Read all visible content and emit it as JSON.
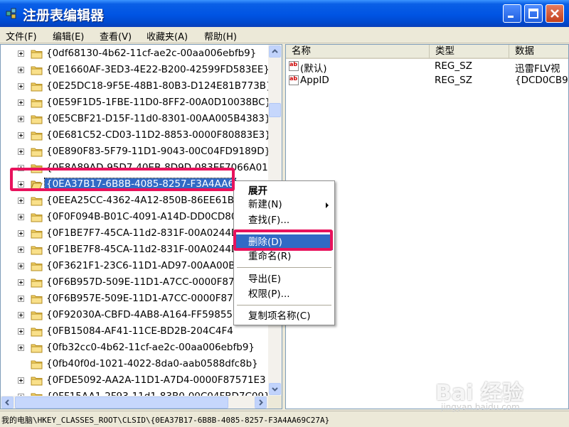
{
  "window": {
    "title": "注册表编辑器",
    "controls": {
      "minimize": "minimize",
      "maximize": "maximize",
      "close": "close"
    }
  },
  "menu": [
    "文件(F)",
    "编辑(E)",
    "查看(V)",
    "收藏夹(A)",
    "帮助(H)"
  ],
  "tree": {
    "items": [
      {
        "label": "{0df68130-4b62-11cf-ae2c-00aa006ebfb9}",
        "expandable": true
      },
      {
        "label": "{0E1660AF-3ED3-4E22-B200-42599FD583EE}",
        "expandable": true
      },
      {
        "label": "{0E25DC18-9F5E-48B1-80B3-D124E81B773B}",
        "expandable": true
      },
      {
        "label": "{0E59F1D5-1FBE-11D0-8FF2-00A0D10038BC}",
        "expandable": true
      },
      {
        "label": "{0E5CBF21-D15F-11d0-8301-00AA005B4383}",
        "expandable": true
      },
      {
        "label": "{0E681C52-CD03-11D2-8853-0000F80883E3}",
        "expandable": true
      },
      {
        "label": "{0E890F83-5F79-11D1-9043-00C04FD9189D}",
        "expandable": true
      },
      {
        "label": "{0E8A89AD-95D7-40EB-8D9D-083EF7066A01",
        "expandable": true
      },
      {
        "label": "{0EA37B17-6B8B-4085-8257-F3A4AA6",
        "expandable": true,
        "selected": true
      },
      {
        "label": "{0EEA25CC-4362-4A12-850B-86EE61B",
        "expandable": true
      },
      {
        "label": "{0F0F094B-B01C-4091-A14D-DD0CD80",
        "expandable": true
      },
      {
        "label": "{0F1BE7F7-45CA-11d2-831F-00A0244D",
        "expandable": true
      },
      {
        "label": "{0F1BE7F8-45CA-11d2-831F-00A0244D",
        "expandable": true
      },
      {
        "label": "{0F3621F1-23C6-11D1-AD97-00AA00B",
        "expandable": true
      },
      {
        "label": "{0F6B957D-509E-11D1-A7CC-0000F87",
        "expandable": true
      },
      {
        "label": "{0F6B957E-509E-11D1-A7CC-0000F87",
        "expandable": true
      },
      {
        "label": "{0F92030A-CBFD-4AB8-A164-FF59855",
        "expandable": true
      },
      {
        "label": "{0FB15084-AF41-11CE-BD2B-204C4F4",
        "expandable": true
      },
      {
        "label": "{0fb32cc0-4b62-11cf-ae2c-00aa006ebfb9}",
        "expandable": true
      },
      {
        "label": "{0fb40f0d-1021-4022-8da0-aab0588dfc8b}",
        "expandable": false
      },
      {
        "label": "{0FDE5092-AA2A-11D1-A7D4-0000F87571E3",
        "expandable": true
      },
      {
        "label": "{0FF15AA1-2F93-11d1-83B0-00C04FBD7C09}",
        "expandable": true
      }
    ]
  },
  "list": {
    "columns": [
      "名称",
      "类型",
      "数据"
    ],
    "rows": [
      {
        "name": "(默认)",
        "type": "REG_SZ",
        "data": "迅雷FLV视"
      },
      {
        "name": "AppID",
        "type": "REG_SZ",
        "data": "{DCD0CB9"
      }
    ]
  },
  "context_menu": {
    "items": [
      {
        "label": "展开",
        "bold": true
      },
      {
        "label": "新建(N)",
        "submenu": true
      },
      {
        "label": "查找(F)..."
      },
      {
        "separator": true
      },
      {
        "label": "删除(D)",
        "highlighted": true
      },
      {
        "label": "重命名(R)"
      },
      {
        "separator": true
      },
      {
        "label": "导出(E)"
      },
      {
        "label": "权限(P)..."
      },
      {
        "separator": true
      },
      {
        "label": "复制项名称(C)"
      }
    ]
  },
  "status": "我的电脑\\HKEY_CLASSES_ROOT\\CLSID\\{0EA37B17-6B8B-4085-8257-F3A4AA69C27A}",
  "watermark": {
    "logo": "Bai 经验",
    "url": "jingyan.baidu.com"
  },
  "colors": {
    "selection": "#316ac5",
    "annotation": "#e8125c",
    "titlebar": "#0054e3"
  }
}
